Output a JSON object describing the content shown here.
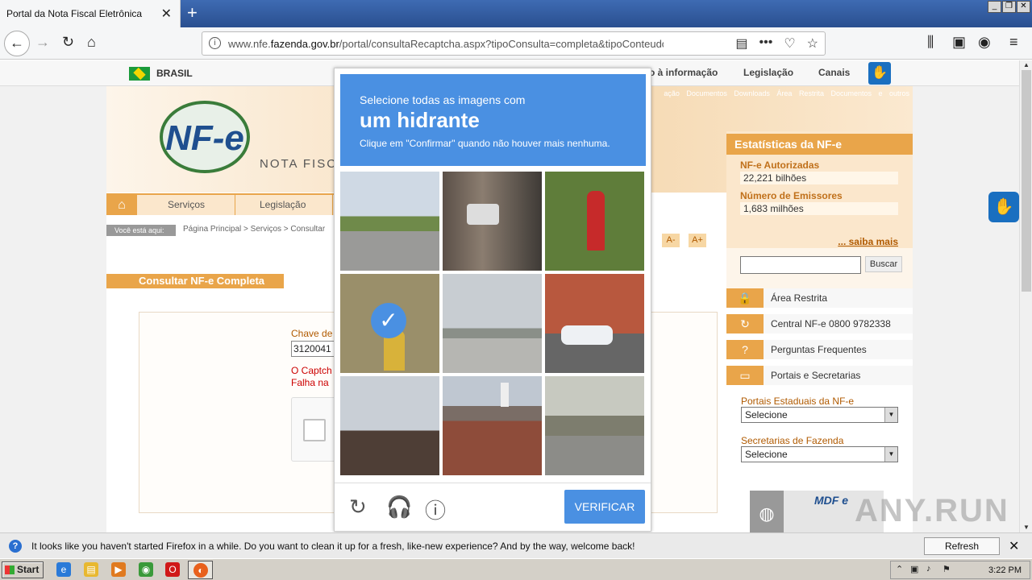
{
  "browser": {
    "tab_title": "Portal da Nota Fiscal Eletrônica",
    "url_prefix": "www.nfe.",
    "url_domain": "fazenda.gov.br",
    "url_path": "/portal/consultaRecaptcha.aspx?tipoConsulta=completa&tipoConteudo=XbSeq"
  },
  "gov_bar": {
    "country": "BRASIL",
    "links": [
      "o à informação",
      "Legislação",
      "Canais"
    ]
  },
  "header": {
    "brand": "NF-e",
    "subtitle": "NOTA FISCA",
    "top_links": "ação Documentos Downloads Área Restrita Documentos e outros"
  },
  "menu": {
    "items": [
      "Serviços",
      "Legislação"
    ]
  },
  "breadcrumb": {
    "label": "Você está aqui:",
    "path": "Página Principal > Serviços > Consultar"
  },
  "font_buttons": [
    "A-",
    "A+"
  ],
  "main": {
    "section_title": "Consultar NF-e Completa",
    "chave_label": "Chave de",
    "chave_value": "3120041",
    "error1": "O Captch",
    "error2": "Falha na"
  },
  "stats": {
    "title": "Estatísticas da NF-e",
    "autorizadas_label": "NF-e Autorizadas",
    "autorizadas_value": "22,221 bilhões",
    "emissores_label": "Número de Emissores",
    "emissores_value": "1,683 milhões",
    "more_link": "... saiba mais"
  },
  "search": {
    "button": "Buscar"
  },
  "side_links": [
    "Área Restrita",
    "Central NF-e 0800 9782338",
    "Perguntas Frequentes",
    "Portais e Secretarias"
  ],
  "selects": {
    "estaduais_label": "Portais Estaduais da NF-e",
    "estaduais_value": "Selecione",
    "fazenda_label": "Secretarias de Fazenda",
    "fazenda_value": "Selecione"
  },
  "mdfe": {
    "label": "MDF e"
  },
  "recaptcha": {
    "instruction": "Selecione todas as imagens com",
    "target": "um hidrante",
    "hint": "Clique em \"Confirmar\" quando não houver mais nenhuma.",
    "verify_label": "VERIFICAR",
    "tiles": [
      {
        "name": "street-trees",
        "selected": false
      },
      {
        "name": "gate-car",
        "selected": false
      },
      {
        "name": "red-hydrant",
        "selected": false
      },
      {
        "name": "yellow-hydrant",
        "selected": true
      },
      {
        "name": "highway",
        "selected": false
      },
      {
        "name": "building-car",
        "selected": false
      },
      {
        "name": "bare-tree",
        "selected": false
      },
      {
        "name": "brick-house",
        "selected": false
      },
      {
        "name": "street-corner",
        "selected": false
      }
    ]
  },
  "notification": {
    "text": "It looks like you haven't started Firefox in a while. Do you want to clean it up for a fresh, like-new experience? And by the way, welcome back!",
    "button": "Refresh Firefox…"
  },
  "taskbar": {
    "start": "Start",
    "clock": "3:22 PM"
  },
  "watermark": "ANY.RUN"
}
